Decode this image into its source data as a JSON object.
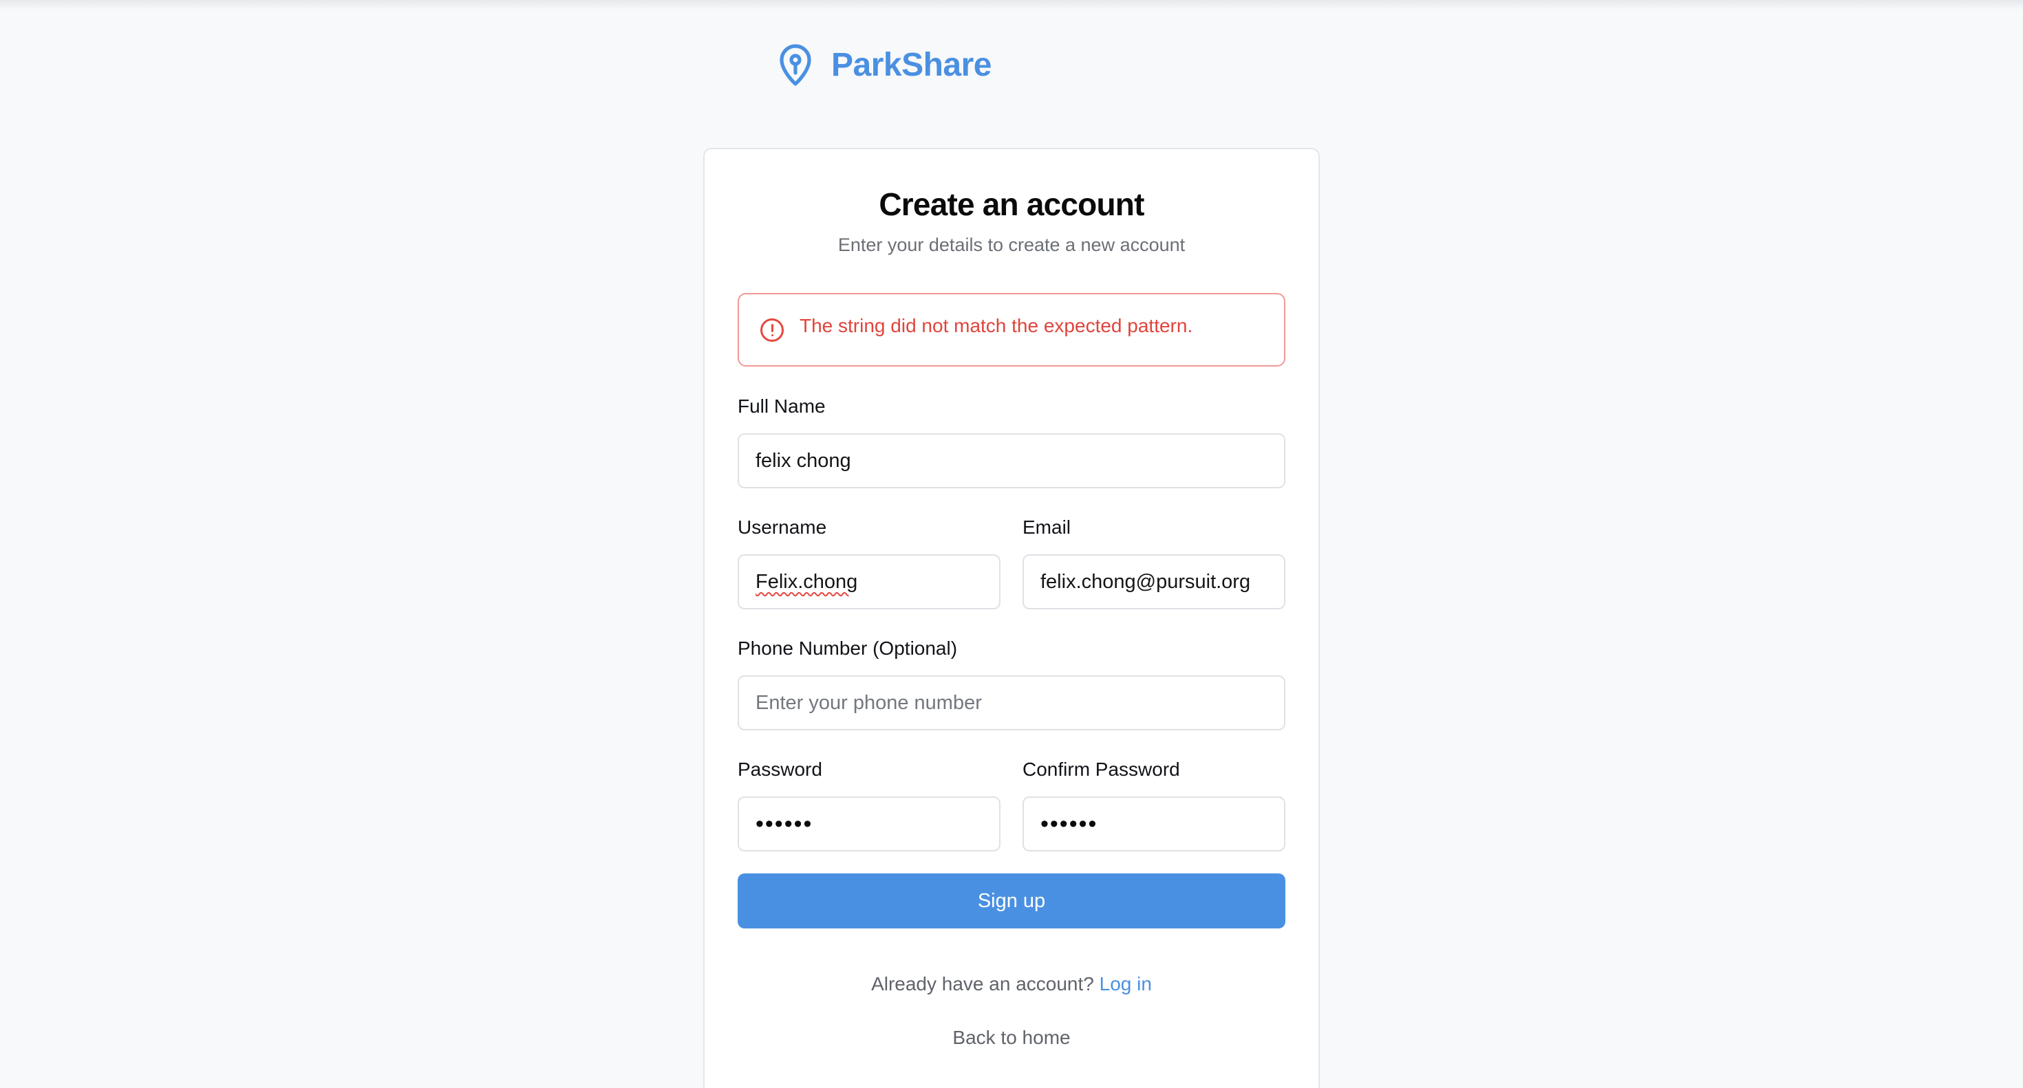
{
  "brand": {
    "name": "ParkShare",
    "logo_icon": "parking-pin-icon",
    "accent_color": "#4a90e2"
  },
  "form": {
    "title": "Create an account",
    "subtitle": "Enter your details to create a new account",
    "error": {
      "icon": "alert-circle-icon",
      "message": "The string did not match the expected pattern.",
      "color": "#e0443c"
    },
    "full_name": {
      "label": "Full Name",
      "value": "felix chong"
    },
    "username": {
      "label": "Username",
      "value": "Felix.chong"
    },
    "email": {
      "label": "Email",
      "value": "felix.chong@pursuit.org"
    },
    "phone": {
      "label": "Phone Number (Optional)",
      "value": "",
      "placeholder": "Enter your phone number"
    },
    "password": {
      "label": "Password",
      "value": "••••••"
    },
    "confirm_password": {
      "label": "Confirm Password",
      "value": "••••••"
    },
    "submit_label": "Sign up"
  },
  "footer": {
    "login_prompt": "Already have an account?",
    "login_link": "Log in",
    "back_home": "Back to home"
  }
}
